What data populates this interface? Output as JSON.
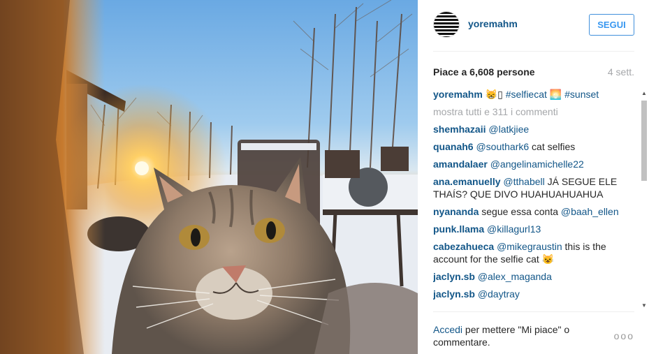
{
  "post": {
    "photo_description_icon": "cat-selfie-photo",
    "author": "yoremahm",
    "follow_label": "SEGUI",
    "likes_text": "Piace a 6,608 persone",
    "time_ago": "4 sett."
  },
  "caption": {
    "user": "yoremahm",
    "emoji1": "😸",
    "box": "▯",
    "hashtag1": "#selfiecat",
    "emoji2": "🌅",
    "hashtag2": "#sunset"
  },
  "show_all_comments": "mostra tutti e 311 i commenti",
  "comments": [
    {
      "user": "shemhazaii",
      "mention": "@latkjiee",
      "text": ""
    },
    {
      "user": "quanah6",
      "mention": "@southark6",
      "text": " cat selfies"
    },
    {
      "user": "amandalaer",
      "mention": "@angelinamichelle22",
      "text": ""
    },
    {
      "user": "ana.emanuelly",
      "mention": "@tthabell",
      "text": " JÁ SEGUE ELE THAÍS? QUE DIVO HUAHUAHUAHUA"
    },
    {
      "user": "nyananda",
      "mention": "",
      "text": "segue essa conta",
      "mention_after": "@baah_ellen"
    },
    {
      "user": "punk.llama",
      "mention": "@killagurl13",
      "text": ""
    },
    {
      "user": "cabezahueca",
      "mention": "@mikegraustin",
      "text": " this is the account for the selfie cat 😺"
    },
    {
      "user": "jaclyn.sb",
      "mention": "@alex_maganda",
      "text": ""
    },
    {
      "user": "jaclyn.sb",
      "mention": "@daytray",
      "text": ""
    }
  ],
  "footer": {
    "login_link": "Accedi",
    "login_text": " per mettere \"Mi piace\" o commentare.",
    "more_icon": "ooo"
  },
  "colors": {
    "link": "#125688",
    "follow": "#3897f0",
    "muted": "#a5a7aa"
  }
}
